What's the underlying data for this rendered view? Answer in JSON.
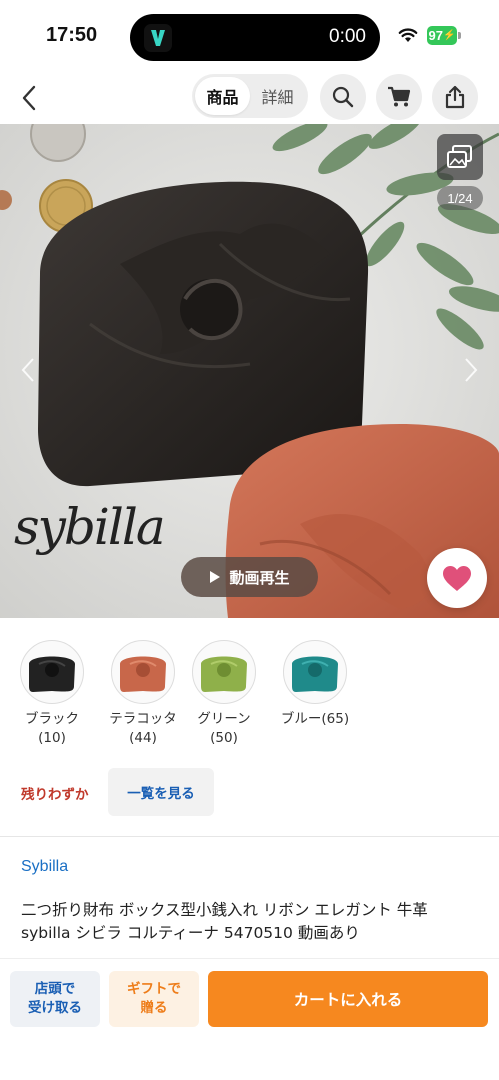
{
  "status_bar": {
    "time": "17:50",
    "timer": "0:00",
    "battery": "97"
  },
  "nav": {
    "tab_product": "商品",
    "tab_detail": "詳細"
  },
  "hero": {
    "image_counter": "1/24",
    "brand_logo_text": "sybilla",
    "video_button_label": "動画再生"
  },
  "colors": [
    {
      "name": "ブラック",
      "count": "(10)",
      "hex": "#222222"
    },
    {
      "name": "テラコッタ",
      "count": "(44)",
      "hex": "#c8674a"
    },
    {
      "name": "グリーン",
      "count": "(50)",
      "hex": "#8fb04a"
    },
    {
      "name": "ブルー(65)",
      "count": "",
      "hex": "#1f8a8a"
    }
  ],
  "stock": {
    "label": "残りわずか",
    "list_button": "一覧を見る"
  },
  "product": {
    "brand": "Sybilla",
    "title": "二つ折り財布 ボックス型小銭入れ リボン エレガント 牛革 sybilla シビラ コルティーナ 5470510 動画あり"
  },
  "bottom_bar": {
    "pickup": "店頭で\n受け取る",
    "gift": "ギフトで\n贈る",
    "cart": "カートに入れる"
  },
  "accent": {
    "orange": "#f6881f",
    "blue": "#1a5fb4",
    "red": "#c0392b",
    "heart": "#e0507a"
  }
}
